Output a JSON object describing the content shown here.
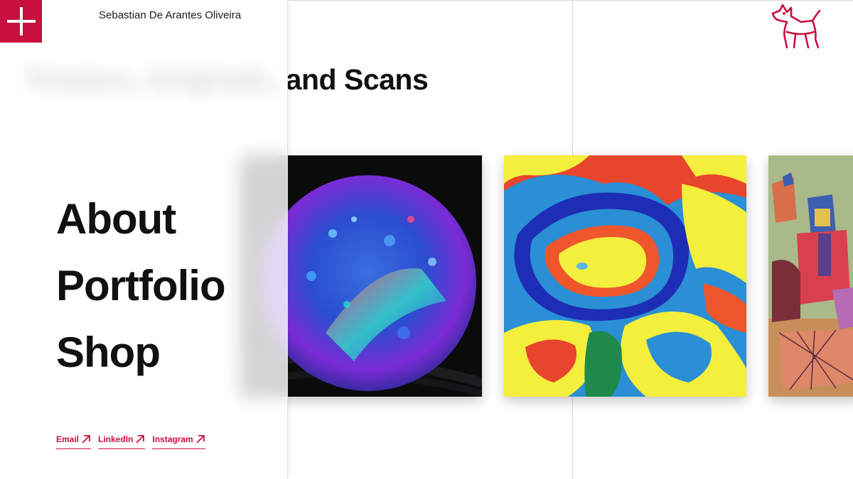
{
  "header": {
    "site_name": "Sebastian De Arantes Oliveira",
    "menu_toggle_icon": "plus-icon",
    "logo_icon": "dog-logo-icon"
  },
  "page": {
    "title": "Posters, Originals, and Scans",
    "cards": [
      {
        "icon": "cosmic-fluid-painting-image"
      },
      {
        "icon": "rainbow-pour-painting-image"
      },
      {
        "icon": "cubist-figure-painting-image"
      }
    ]
  },
  "menu": {
    "items": [
      {
        "label": "About"
      },
      {
        "label": "Portfolio"
      },
      {
        "label": "Shop"
      }
    ],
    "links": [
      {
        "label": "Email",
        "icon": "arrow-up-right-icon"
      },
      {
        "label": "LinkedIn",
        "icon": "arrow-up-right-icon"
      },
      {
        "label": "Instagram",
        "icon": "arrow-up-right-icon"
      }
    ]
  },
  "colors": {
    "accent": "#c8103e",
    "text": "#111111",
    "background": "#ffffff"
  }
}
